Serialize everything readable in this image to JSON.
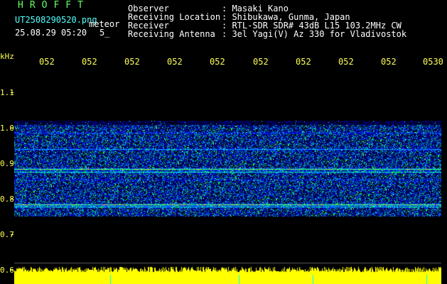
{
  "header": {
    "brand": "HROFFT",
    "filename": "UT2508290520.png",
    "meteor_label": "meteor",
    "timestamp": "25.08.29 05:20",
    "count": "5_",
    "fields": [
      {
        "label": "Observer",
        "value": ": Masaki Kano"
      },
      {
        "label": "Receiving Location",
        "value": ": Shibukawa, Gunma, Japan"
      },
      {
        "label": "Receiver",
        "value": ": RTL-SDR SDR# 43dB L15 103.2MHz CW"
      },
      {
        "label": "Receiving Antenna",
        "value": ": 3el Yagi(V) Az 330 for Vladivostok"
      }
    ]
  },
  "axes": {
    "y_unit": "kHz",
    "y_ticks": [
      "1.1",
      "1.0",
      "0.9",
      "0.8",
      "0.7",
      "0.6"
    ],
    "x_ticks": [
      "052",
      "052",
      "052",
      "052",
      "052",
      "052",
      "052",
      "052",
      "052",
      "0530"
    ]
  },
  "colors": {
    "background": "#000000",
    "text_white": "#ffffff",
    "text_yellow": "#ffff55",
    "brand_green": "#66ff66",
    "meter_fill": "#ffff00",
    "meter_marker": "#00ffff"
  }
}
